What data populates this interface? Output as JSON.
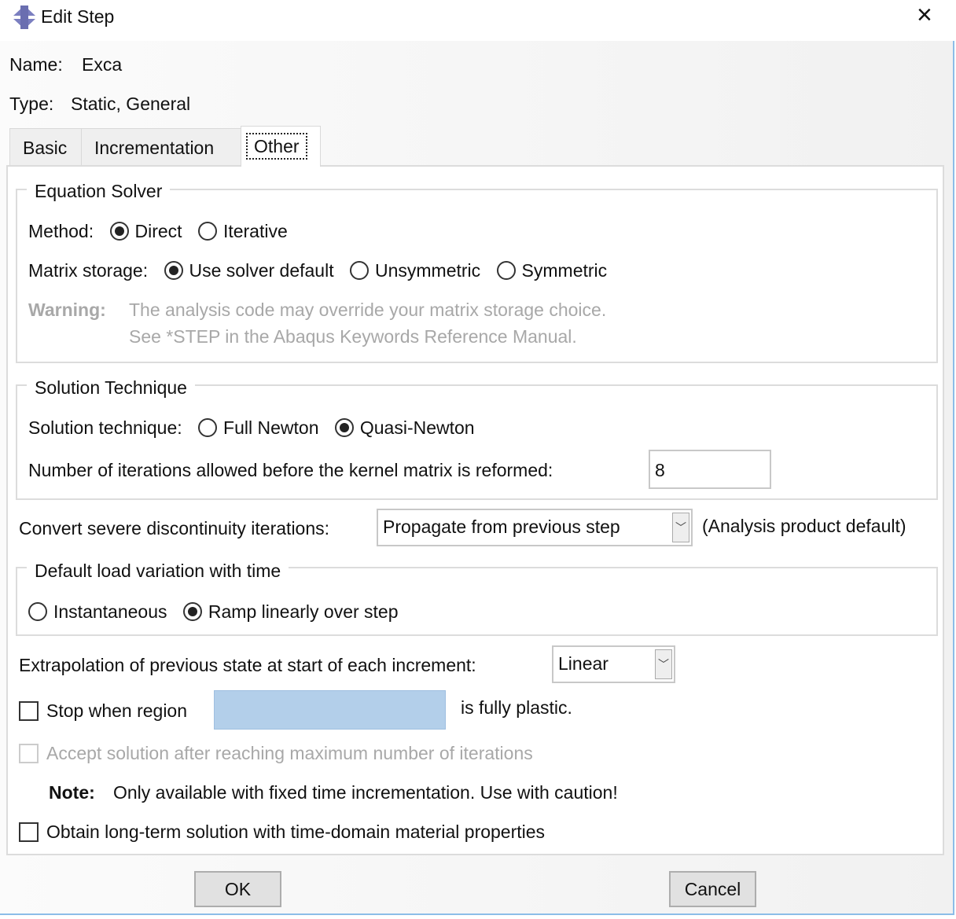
{
  "window": {
    "title": "Edit Step",
    "icon": "abaqus-step-icon",
    "close": "×"
  },
  "header": {
    "name_label": "Name:",
    "name_value": "Exca",
    "type_label": "Type:",
    "type_value": "Static, General"
  },
  "tabs": [
    {
      "label": "Basic"
    },
    {
      "label": "Incrementation"
    },
    {
      "label": "Other",
      "active": true
    }
  ],
  "equation_solver": {
    "title": "Equation Solver",
    "method_label": "Method:",
    "method_options": [
      "Direct",
      "Iterative"
    ],
    "method_selected": "Direct",
    "storage_label": "Matrix storage:",
    "storage_options": [
      "Use solver default",
      "Unsymmetric",
      "Symmetric"
    ],
    "storage_selected": "Use solver default",
    "warning_label": "Warning:",
    "warning_line1": "The analysis code may override your matrix storage choice.",
    "warning_line2": "See *STEP in the Abaqus Keywords Reference Manual."
  },
  "solution_technique": {
    "title": "Solution Technique",
    "label": "Solution technique:",
    "options": [
      "Full Newton",
      "Quasi-Newton"
    ],
    "selected": "Quasi-Newton",
    "iterations_label": "Number of iterations allowed before the kernel matrix is reformed:",
    "iterations_value": "8"
  },
  "discontinuity": {
    "label": "Convert severe discontinuity iterations:",
    "value": "Propagate from previous step",
    "note": "(Analysis product default)"
  },
  "load_variation": {
    "title": "Default load variation with time",
    "options": [
      "Instantaneous",
      "Ramp linearly over step"
    ],
    "selected": "Ramp linearly over step"
  },
  "extrapolation": {
    "label": "Extrapolation of previous state at start of each increment:",
    "value": "Linear"
  },
  "stop_region": {
    "label": "Stop when region",
    "suffix": "is fully plastic.",
    "checked": false,
    "value": ""
  },
  "accept_solution": {
    "label": "Accept solution after reaching maximum number of iterations",
    "checked": false,
    "disabled": true
  },
  "note": {
    "label": "Note:",
    "text": "Only available with fixed time incrementation. Use with caution!"
  },
  "long_term": {
    "label": "Obtain long-term solution with time-domain material properties",
    "checked": false
  },
  "buttons": {
    "ok": "OK",
    "cancel": "Cancel"
  },
  "colors": {
    "region_field": "#b3cfea",
    "window_border": "#8cbde8"
  }
}
